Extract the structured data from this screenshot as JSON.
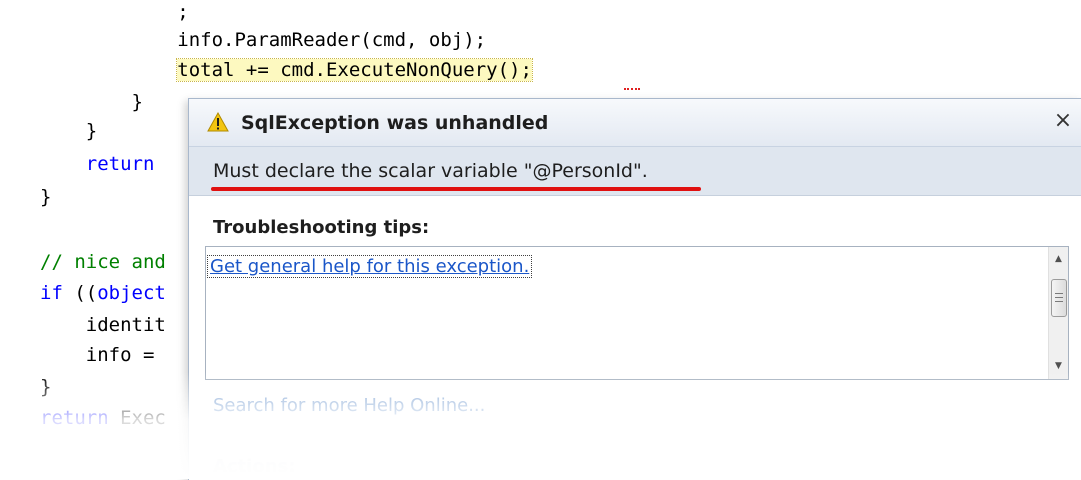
{
  "editor": {
    "lines": [
      {
        "id": "l0",
        "segments": [
          {
            "cls": "plain",
            "text": "            ;"
          }
        ]
      },
      {
        "id": "l1",
        "segments": [
          {
            "cls": "plain",
            "text": "            info.ParamReader(cmd, obj);"
          }
        ]
      },
      {
        "id": "l2",
        "segments": [
          {
            "cls": "plain",
            "text": "            "
          },
          {
            "cls": "plain hl",
            "text": "total += cmd.ExecuteNonQuery();"
          }
        ]
      },
      {
        "id": "l3",
        "segments": [
          {
            "cls": "plain",
            "text": "        }"
          }
        ]
      },
      {
        "id": "l4",
        "segments": [
          {
            "cls": "plain",
            "text": "    }"
          }
        ]
      },
      {
        "id": "l5",
        "segments": [
          {
            "cls": "plain",
            "text": "    "
          },
          {
            "cls": "kw",
            "text": "return"
          }
        ]
      },
      {
        "id": "l6",
        "segments": [
          {
            "cls": "plain",
            "text": "}"
          }
        ]
      },
      {
        "id": "l7",
        "segments": [
          {
            "cls": "plain",
            "text": ""
          }
        ]
      },
      {
        "id": "l8",
        "segments": [
          {
            "cls": "cmt",
            "text": "// nice and"
          }
        ]
      },
      {
        "id": "l9",
        "segments": [
          {
            "cls": "kw",
            "text": "if"
          },
          {
            "cls": "plain",
            "text": " (("
          },
          {
            "cls": "kw",
            "text": "object"
          }
        ]
      },
      {
        "id": "l10",
        "segments": [
          {
            "cls": "plain",
            "text": "    identit"
          }
        ]
      },
      {
        "id": "l11",
        "segments": [
          {
            "cls": "plain",
            "text": "    info = "
          }
        ]
      },
      {
        "id": "l12",
        "segments": [
          {
            "cls": "plain",
            "text": "}"
          }
        ]
      },
      {
        "id": "l13",
        "segments": [
          {
            "cls": "kw",
            "text": "return"
          },
          {
            "cls": "plain",
            "text": " Exec"
          }
        ]
      }
    ]
  },
  "popup": {
    "title": "SqlException was unhandled",
    "close_label": "×",
    "message": "Must declare the scalar variable \"@PersonId\".",
    "tips_heading": "Troubleshooting tips:",
    "tips": [
      "Get general help for this exception."
    ],
    "scroll_up_label": "▲",
    "scroll_down_label": "▼",
    "more_help_link": "Search for more Help Online...",
    "actions_heading": "Actions:"
  },
  "colors": {
    "keyword": "#0000ff",
    "comment": "#008000",
    "link": "#1a56c8",
    "highlight": "#fdf9c0",
    "annotation_red": "#e01010",
    "warning_yellow": "#f3c511"
  },
  "icons": {
    "popup_icon": "warning-triangle-icon"
  }
}
